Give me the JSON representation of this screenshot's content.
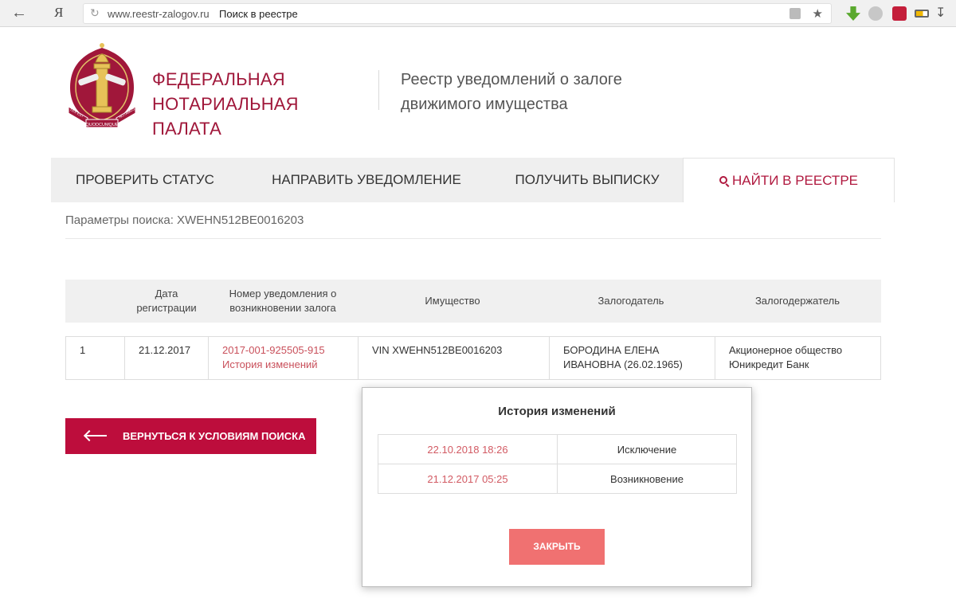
{
  "browser": {
    "url": "www.reestr-zalogov.ru",
    "page_title": "Поиск в реестре",
    "yandex_label": "Я"
  },
  "header": {
    "org_name_line1": "ФЕДЕРАЛЬНАЯ",
    "org_name_line2": "НОТАРИАЛЬНАЯ ПАЛАТА",
    "registry_line1": "Реестр уведомлений о залоге",
    "registry_line2": "движимого имущества",
    "logo_ribbon_left": "LEX EST",
    "logo_ribbon_center": "QUODCUMQUE",
    "logo_ribbon_right": "NOTAMUS"
  },
  "nav": {
    "items": [
      {
        "label": "ПРОВЕРИТЬ СТАТУС"
      },
      {
        "label": "НАПРАВИТЬ УВЕДОМЛЕНИЕ"
      },
      {
        "label": "ПОЛУЧИТЬ ВЫПИСКУ"
      },
      {
        "label": "НАЙТИ В РЕЕСТРЕ",
        "active": true
      }
    ]
  },
  "search": {
    "params_text": "Параметры поиска: XWEHN512BE0016203"
  },
  "table": {
    "headers": {
      "num": "",
      "date": "Дата регистрации",
      "notice": "Номер уведомления о возникновении залога",
      "property": "Имущество",
      "pledgor": "Залогодатель",
      "pledgee": "Залогодержатель"
    },
    "rows": [
      {
        "num": "1",
        "date": "21.12.2017",
        "notice_number": "2017-001-925505-915",
        "history_link": "История изменений",
        "property": "VIN XWEHN512BE0016203",
        "pledgor": "БОРОДИНА ЕЛЕНА ИВАНОВНА (26.02.1965)",
        "pledgee": "Акционерное общество Юникредит Банк"
      }
    ]
  },
  "back_button": {
    "label": "ВЕРНУТЬСЯ К УСЛОВИЯМ ПОИСКА"
  },
  "modal": {
    "title": "История изменений",
    "rows": [
      {
        "datetime": "22.10.2018 18:26",
        "event": "Исключение"
      },
      {
        "datetime": "21.12.2017 05:25",
        "event": "Возникновение"
      }
    ],
    "close_label": "ЗАКРЫТЬ"
  },
  "colors": {
    "brand": "#a0173a",
    "button": "#bd0d3c",
    "link": "#c9505b",
    "close_button": "#f07171"
  }
}
